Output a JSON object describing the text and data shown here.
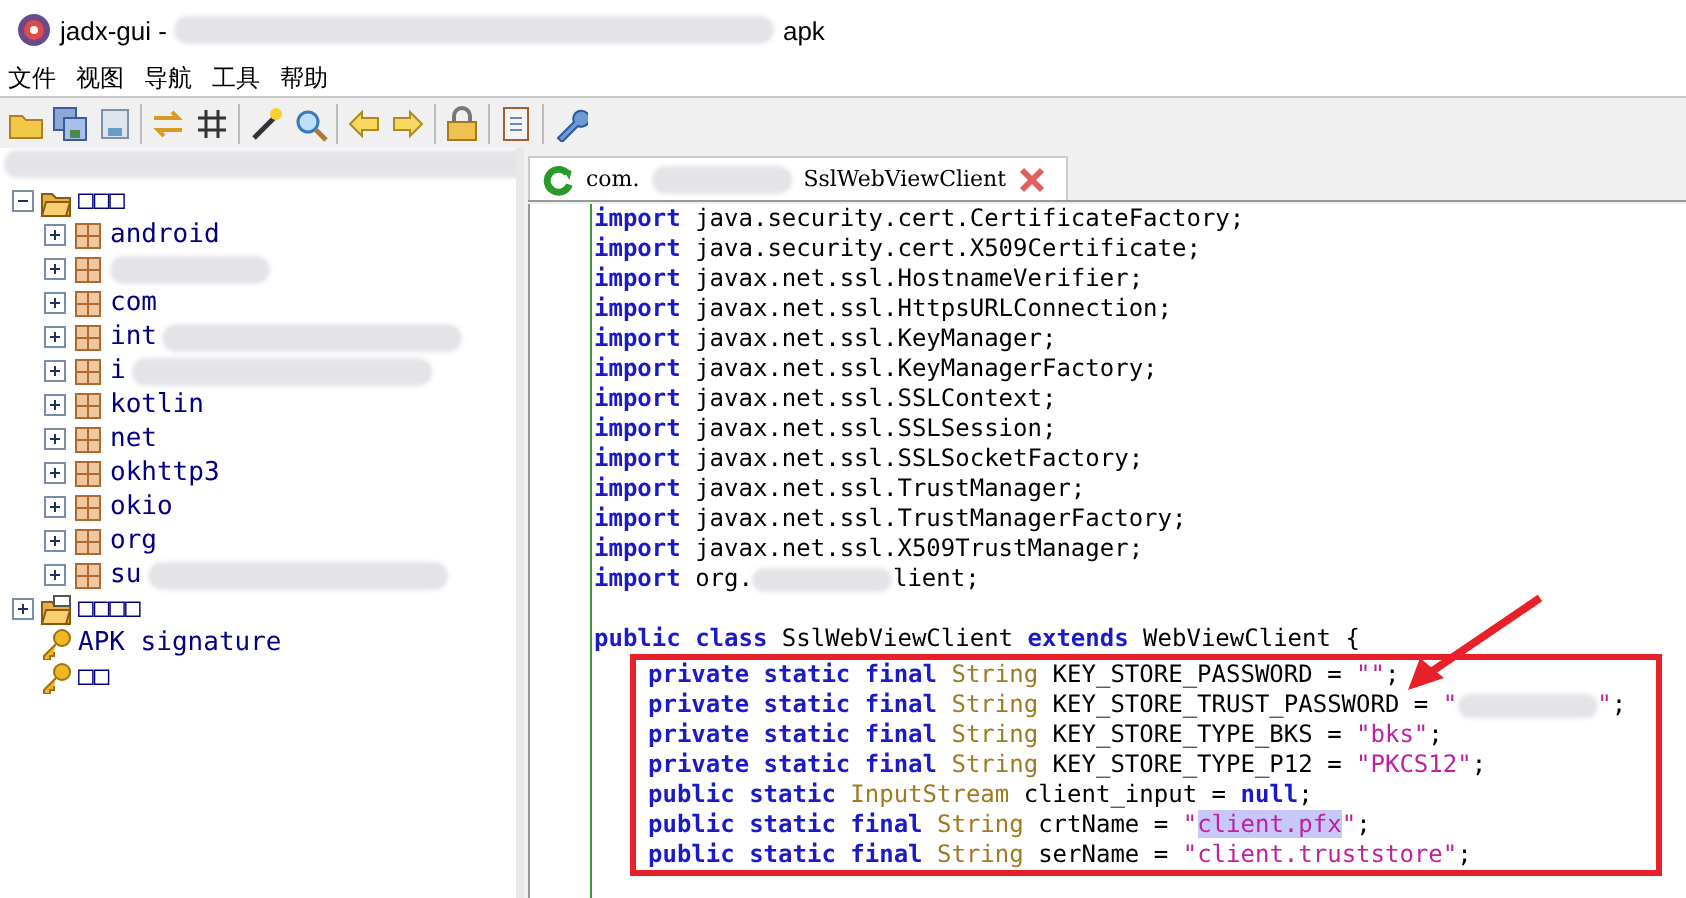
{
  "window": {
    "title_start": "jadx-gui -",
    "title_end": "apk"
  },
  "menu": [
    "文件",
    "视图",
    "导航",
    "工具",
    "帮助"
  ],
  "toolbar": [
    {
      "kind": "open"
    },
    {
      "kind": "save-all"
    },
    {
      "kind": "save"
    },
    {
      "kind": "sep"
    },
    {
      "kind": "sync"
    },
    {
      "kind": "grid"
    },
    {
      "kind": "sep"
    },
    {
      "kind": "wand"
    },
    {
      "kind": "search"
    },
    {
      "kind": "sep"
    },
    {
      "kind": "back"
    },
    {
      "kind": "forward"
    },
    {
      "kind": "sep"
    },
    {
      "kind": "lock"
    },
    {
      "kind": "sep"
    },
    {
      "kind": "log"
    },
    {
      "kind": "sep"
    },
    {
      "kind": "wrench"
    }
  ],
  "tree": [
    {
      "label": "□□□",
      "kind": "folder",
      "expanded": true,
      "children": [
        {
          "label": "android",
          "redacted": false
        },
        {
          "redacted": true
        },
        {
          "label": "com",
          "redacted": false
        },
        {
          "label": "int",
          "redacted": true
        },
        {
          "label": "i",
          "redacted": true
        },
        {
          "label": "kotlin",
          "redacted": false
        },
        {
          "label": "net",
          "redacted": false
        },
        {
          "label": "okhttp3",
          "redacted": false
        },
        {
          "label": "okio",
          "redacted": false
        },
        {
          "label": "org",
          "redacted": false
        },
        {
          "label": "su",
          "redacted": true
        }
      ]
    },
    {
      "label": "□□□□",
      "kind": "binfolder",
      "expanded": false
    },
    {
      "label": "APK signature",
      "kind": "key"
    },
    {
      "label": "□□",
      "kind": "key"
    }
  ],
  "tabs": [
    {
      "prefix": "com.",
      "name": "SslWebViewClient",
      "selected": true
    }
  ],
  "code": [
    {
      "kind": "line",
      "tokens": [
        {
          "kind": "kw",
          "text": "import"
        },
        {
          "kind": "plain",
          "text": " java.security.cert.CertificateFactory;"
        }
      ]
    },
    {
      "kind": "line",
      "tokens": [
        {
          "kind": "kw",
          "text": "import"
        },
        {
          "kind": "plain",
          "text": " java.security.cert.X509Certificate;"
        }
      ]
    },
    {
      "kind": "line",
      "tokens": [
        {
          "kind": "kw",
          "text": "import"
        },
        {
          "kind": "plain",
          "text": " javax.net.ssl.HostnameVerifier;"
        }
      ]
    },
    {
      "kind": "line",
      "tokens": [
        {
          "kind": "kw",
          "text": "import"
        },
        {
          "kind": "plain",
          "text": " javax.net.ssl.HttpsURLConnection;"
        }
      ]
    },
    {
      "kind": "line",
      "tokens": [
        {
          "kind": "kw",
          "text": "import"
        },
        {
          "kind": "plain",
          "text": " javax.net.ssl.KeyManager;"
        }
      ]
    },
    {
      "kind": "line",
      "tokens": [
        {
          "kind": "kw",
          "text": "import"
        },
        {
          "kind": "plain",
          "text": " javax.net.ssl.KeyManagerFactory;"
        }
      ]
    },
    {
      "kind": "line",
      "tokens": [
        {
          "kind": "kw",
          "text": "import"
        },
        {
          "kind": "plain",
          "text": " javax.net.ssl.SSLContext;"
        }
      ]
    },
    {
      "kind": "line",
      "tokens": [
        {
          "kind": "kw",
          "text": "import"
        },
        {
          "kind": "plain",
          "text": " javax.net.ssl.SSLSession;"
        }
      ]
    },
    {
      "kind": "line",
      "tokens": [
        {
          "kind": "kw",
          "text": "import"
        },
        {
          "kind": "plain",
          "text": " javax.net.ssl.SSLSocketFactory;"
        }
      ]
    },
    {
      "kind": "line",
      "tokens": [
        {
          "kind": "kw",
          "text": "import"
        },
        {
          "kind": "plain",
          "text": " javax.net.ssl.TrustManager;"
        }
      ]
    },
    {
      "kind": "line",
      "tokens": [
        {
          "kind": "kw",
          "text": "import"
        },
        {
          "kind": "plain",
          "text": " javax.net.ssl.TrustManagerFactory;"
        }
      ]
    },
    {
      "kind": "line",
      "tokens": [
        {
          "kind": "kw",
          "text": "import"
        },
        {
          "kind": "plain",
          "text": " javax.net.ssl.X509TrustManager;"
        }
      ]
    },
    {
      "kind": "line",
      "tokens": [
        {
          "kind": "kw",
          "text": "import"
        },
        {
          "kind": "plain",
          "text": " org."
        },
        {
          "kind": "redacted"
        },
        {
          "kind": "plain",
          "text": "lient;"
        }
      ]
    },
    {
      "kind": "blank"
    },
    {
      "kind": "line",
      "tokens": [
        {
          "kind": "kw",
          "text": "public class"
        },
        {
          "kind": "plain",
          "text": " SslWebViewClient "
        },
        {
          "kind": "kw",
          "text": "extends"
        },
        {
          "kind": "plain",
          "text": " WebViewClient {"
        }
      ]
    }
  ],
  "highlight_box": {
    "arrow": true,
    "lines": [
      {
        "kind": "line",
        "tokens": [
          {
            "kind": "kw",
            "text": "private static final"
          },
          {
            "kind": "type",
            "text": " String"
          },
          {
            "kind": "plain",
            "text": " KEY_STORE_PASSWORD = "
          },
          {
            "kind": "str",
            "text": "\"\""
          },
          {
            "kind": "plain",
            "text": ";"
          }
        ]
      },
      {
        "kind": "line",
        "tokens": [
          {
            "kind": "kw",
            "text": "private static final"
          },
          {
            "kind": "type",
            "text": " String"
          },
          {
            "kind": "plain",
            "text": " KEY_STORE_TRUST_PASSWORD = "
          },
          {
            "kind": "str",
            "text": "\""
          },
          {
            "kind": "redacted"
          },
          {
            "kind": "str",
            "text": "\""
          },
          {
            "kind": "plain",
            "text": ";"
          }
        ]
      },
      {
        "kind": "line",
        "tokens": [
          {
            "kind": "kw",
            "text": "private static final"
          },
          {
            "kind": "type",
            "text": " String"
          },
          {
            "kind": "plain",
            "text": " KEY_STORE_TYPE_BKS = "
          },
          {
            "kind": "str",
            "text": "\"bks\""
          },
          {
            "kind": "plain",
            "text": ";"
          }
        ]
      },
      {
        "kind": "line",
        "tokens": [
          {
            "kind": "kw",
            "text": "private static final"
          },
          {
            "kind": "type",
            "text": " String"
          },
          {
            "kind": "plain",
            "text": " KEY_STORE_TYPE_P12 = "
          },
          {
            "kind": "str",
            "text": "\"PKCS12\""
          },
          {
            "kind": "plain",
            "text": ";"
          }
        ]
      },
      {
        "kind": "line",
        "tokens": [
          {
            "kind": "kw",
            "text": "public static"
          },
          {
            "kind": "type",
            "text": " InputStream"
          },
          {
            "kind": "plain",
            "text": " client_input = "
          },
          {
            "kind": "kw",
            "text": "null"
          },
          {
            "kind": "plain",
            "text": ";"
          }
        ]
      },
      {
        "kind": "line",
        "tokens": [
          {
            "kind": "kw",
            "text": "public static final"
          },
          {
            "kind": "type",
            "text": " String"
          },
          {
            "kind": "plain",
            "text": " crtName = "
          },
          {
            "kind": "str",
            "text": "\""
          },
          {
            "kind": "selstr",
            "text": "client.pfx"
          },
          {
            "kind": "str",
            "text": "\""
          },
          {
            "kind": "plain",
            "text": ";"
          }
        ]
      },
      {
        "kind": "line",
        "tokens": [
          {
            "kind": "kw",
            "text": "public static final"
          },
          {
            "kind": "type",
            "text": " String"
          },
          {
            "kind": "plain",
            "text": " serName = "
          },
          {
            "kind": "str",
            "text": "\"client.truststore\""
          },
          {
            "kind": "plain",
            "text": ";"
          }
        ]
      }
    ]
  }
}
